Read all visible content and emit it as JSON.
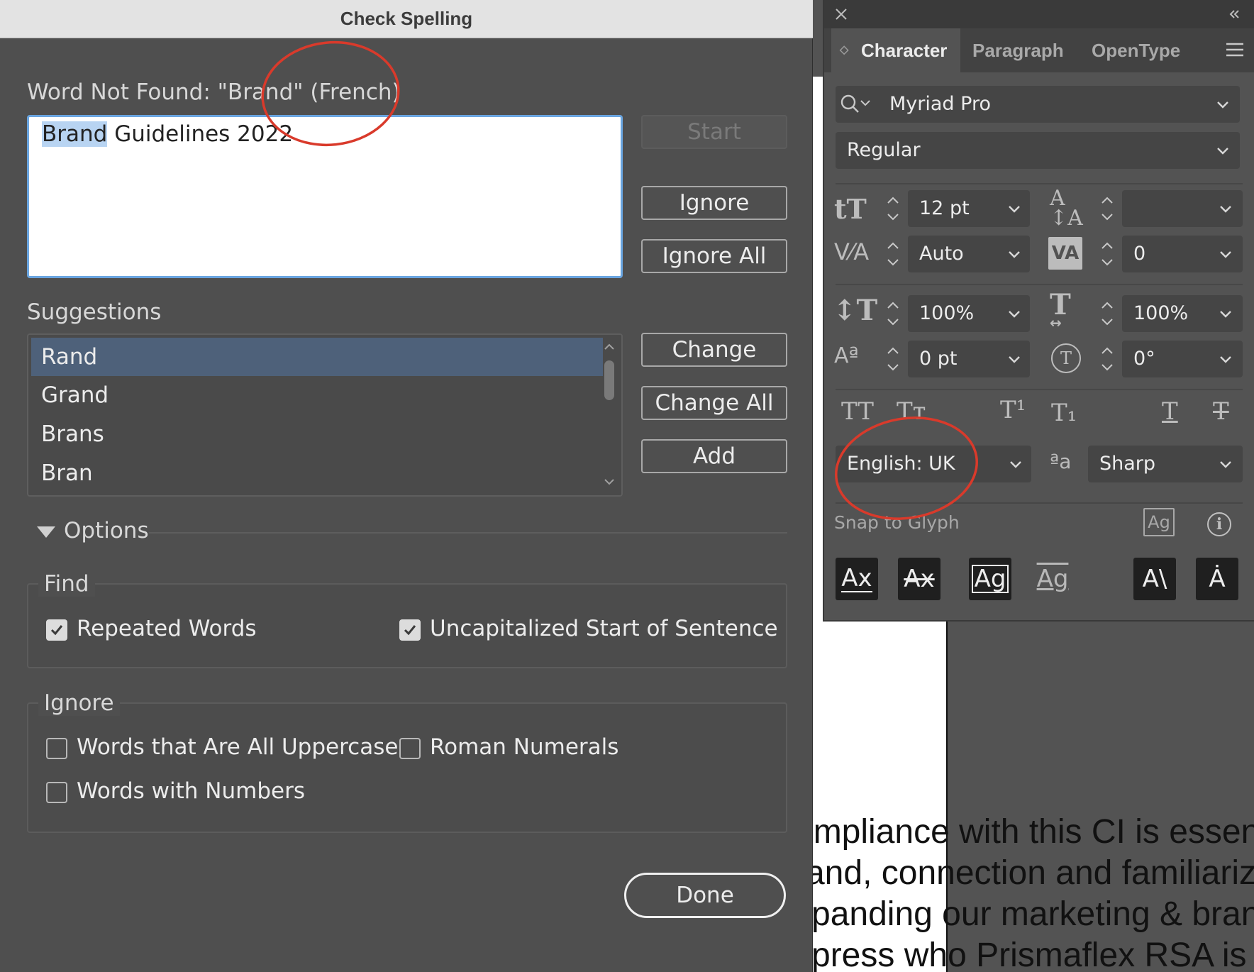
{
  "dialog": {
    "title": "Check Spelling",
    "word_not_found": "Word Not Found: \"Brand\" (French)",
    "text_highlighted": "Brand",
    "text_rest": " Guidelines 2022",
    "buttons": {
      "start": "Start",
      "ignore": "Ignore",
      "ignore_all": "Ignore All",
      "change": "Change",
      "change_all": "Change All",
      "add": "Add",
      "done": "Done"
    },
    "suggestions_label": "Suggestions",
    "suggestions": [
      "Rand",
      "Grand",
      "Brans",
      "Bran"
    ],
    "selected_suggestion": "Rand",
    "options_label": "Options",
    "find": {
      "label": "Find",
      "repeated_words": "Repeated Words",
      "uncapitalized": "Uncapitalized Start of Sentence"
    },
    "ignore": {
      "label": "Ignore",
      "uppercase": "Words that Are All Uppercase",
      "roman": "Roman Numerals",
      "numbers": "Words with Numbers"
    }
  },
  "panel": {
    "tabs": [
      "Character",
      "Paragraph",
      "OpenType"
    ],
    "active_tab": "Character",
    "font_family": "Myriad Pro",
    "font_style": "Regular",
    "font_size": "12 pt",
    "leading": "",
    "kerning": "Auto",
    "tracking": "0",
    "vertical_scale": "100%",
    "horizontal_scale": "100%",
    "baseline_shift": "0 pt",
    "rotation": "0°",
    "language": "English: UK",
    "anti_alias": "Sharp",
    "snap_to_glyph": "Snap to Glyph"
  },
  "document": {
    "lines": [
      "ompliance with this CI is essenti",
      "rand, connection and familiariza",
      "xpanding our marketing & branc",
      "xpress who Prismaflex RSA is an"
    ]
  },
  "annotation_color": "#d93a2b",
  "highlight_color": "#4e617a"
}
